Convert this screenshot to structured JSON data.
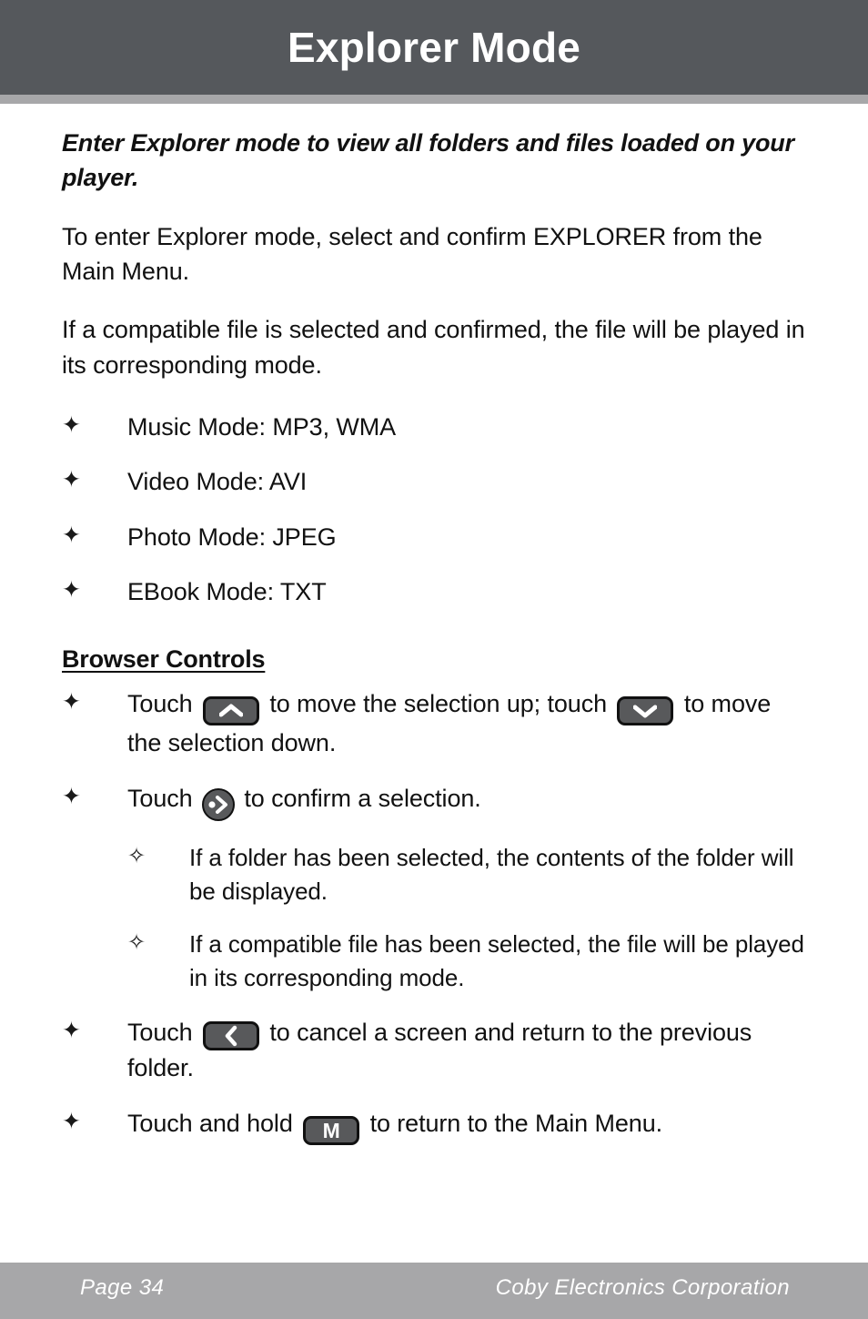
{
  "header": {
    "title": "Explorer Mode",
    "bar_color": "#55585c",
    "rule_color": "#a7a7a9"
  },
  "body": {
    "lead": "Enter Explorer mode to view all folders and files loaded on your player.",
    "paragraph_1": "To enter Explorer mode, select and confirm EXPLORER from the Main Menu.",
    "paragraph_2": "If a compatible file is selected and confirmed, the file will be played in its corresponding mode.",
    "mode_bullets": [
      {
        "marker": "✦",
        "text": "Music Mode: MP3, WMA"
      },
      {
        "marker": "✦",
        "text": "Video Mode: AVI"
      },
      {
        "marker": "✦",
        "text": "Photo Mode: JPEG"
      },
      {
        "marker": "✦",
        "text": "EBook Mode: TXT"
      }
    ],
    "section_heading": "Browser Controls",
    "controls": {
      "nav_marker": "✦",
      "nav_text_1": "Touch",
      "nav_text_2": "to move the selection up; touch",
      "nav_text_3": "to move the selection down.",
      "confirm_marker": "✦",
      "confirm_text_1": "Touch",
      "confirm_text_2": "to confirm a selection.",
      "sub_bullets": [
        {
          "marker": "✧",
          "text": "If a folder has been selected, the contents of the folder will be displayed."
        },
        {
          "marker": "✧",
          "text": "If a compatible file has been selected, the file will be played in its corresponding mode."
        }
      ],
      "cancel_marker": "✦",
      "cancel_text_1": "Touch",
      "cancel_text_2": "to cancel a screen and return to the previous folder.",
      "menu_marker": "✦",
      "menu_text_1": "Touch and hold",
      "menu_text_2": "to return to the Main Menu.",
      "menu_key_label": "M"
    },
    "key_color": "#58595b",
    "key_border_color": "#111111"
  },
  "footer": {
    "page_label": "Page 34",
    "company": "Coby Electronics Corporation",
    "bar_color": "#a7a7a9"
  }
}
